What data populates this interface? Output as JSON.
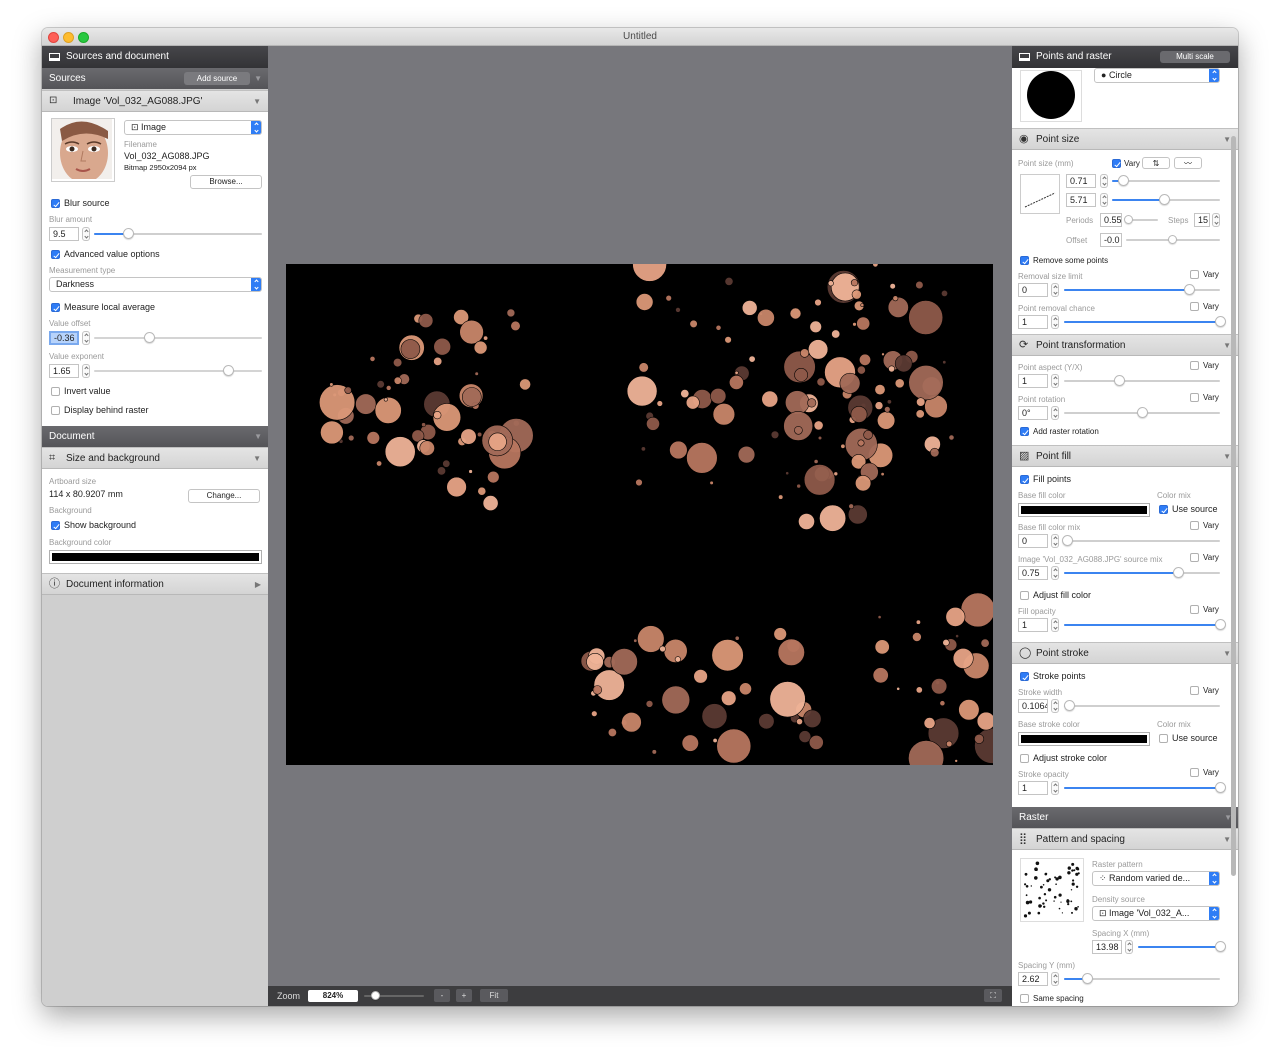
{
  "window": {
    "title": "Untitled"
  },
  "left_panel": {
    "header": "Sources and document",
    "sources_bar": "Sources",
    "add_source_label": "Add source",
    "image_source_title": "Image 'Vol_032_AG088.JPG'",
    "source_type": "Image",
    "filename_label": "Filename",
    "filename": "Vol_032_AG088.JPG",
    "bitmap_info": "Bitmap 2950x2094 px",
    "browse_label": "Browse...",
    "blur_source_label": "Blur source",
    "blur_amount_label": "Blur amount",
    "blur_amount": "9.5",
    "blur_slider": 0.2,
    "advanced_label": "Advanced value options",
    "measurement_type_label": "Measurement type",
    "measurement_type": "Darkness",
    "measure_local_label": "Measure local average",
    "value_offset_label": "Value offset",
    "value_offset": "-0.36",
    "value_offset_slider": 0.33,
    "value_exponent_label": "Value exponent",
    "value_exponent": "1.65",
    "value_exponent_slider": 0.8,
    "invert_label": "Invert value",
    "display_behind_label": "Display behind raster",
    "document_bar": "Document",
    "size_bg_title": "Size and background",
    "artboard_size_label": "Artboard size",
    "artboard_size": "114 x 80.9207 mm",
    "change_label": "Change...",
    "background_label": "Background",
    "show_background_label": "Show background",
    "background_color_label": "Background color",
    "background_color": "#000000",
    "doc_info_title": "Document information"
  },
  "zoom": {
    "label": "Zoom",
    "value": "824%",
    "minus": "-",
    "plus": "+",
    "fit": "Fit",
    "slider": 0.2
  },
  "right_panel": {
    "header": "Points and raster",
    "multi_scale": "Multi scale",
    "shape": "Circle",
    "point_size_title": "Point size",
    "point_size_label": "Point size (mm)",
    "vary_label": "Vary",
    "size_min": "0.71",
    "size_max": "5.71",
    "size_min_slider": 0.1,
    "size_max_slider": 0.48,
    "periods_label": "Periods",
    "periods": "0.55",
    "steps_label": "Steps",
    "steps": "15",
    "offset_label": "Offset",
    "offset": "-0.0",
    "remove_points_label": "Remove some points",
    "removal_limit_label": "Removal size limit",
    "removal_limit": "0",
    "removal_limit_slider": 0.8,
    "removal_chance_label": "Point removal chance",
    "removal_chance": "1",
    "removal_chance_slider": 1.0,
    "transform_title": "Point transformation",
    "aspect_label": "Point aspect (Y/X)",
    "aspect": "1",
    "aspect_slider": 0.35,
    "rotation_label": "Point rotation",
    "rotation": "0°",
    "rotation_slider": 0.5,
    "add_raster_rotation_label": "Add raster rotation",
    "fill_title": "Point fill",
    "fill_points_label": "Fill points",
    "base_fill_color_label": "Base fill color",
    "color_mix_label": "Color mix",
    "use_source_label": "Use source",
    "base_fill_mix_label": "Base fill color mix",
    "base_fill_mix": "0",
    "base_fill_mix_slider": 0.02,
    "source_mix_label": "Image 'Vol_032_AG088.JPG' source mix",
    "source_mix": "0.75",
    "source_mix_slider": 0.73,
    "adjust_fill_label": "Adjust fill color",
    "fill_opacity_label": "Fill opacity",
    "fill_opacity": "1",
    "fill_opacity_slider": 1.0,
    "stroke_title": "Point stroke",
    "stroke_points_label": "Stroke points",
    "stroke_width_label": "Stroke width",
    "stroke_width": "0.1064",
    "stroke_width_slider": 0.03,
    "base_stroke_color_label": "Base stroke color",
    "adjust_stroke_label": "Adjust stroke color",
    "stroke_opacity_label": "Stroke opacity",
    "stroke_opacity": "1",
    "stroke_opacity_slider": 1.0,
    "raster_bar": "Raster",
    "pattern_title": "Pattern and spacing",
    "raster_pattern_label": "Raster pattern",
    "raster_pattern": "Random varied de...",
    "density_source_label": "Density source",
    "density_source": "Image 'Vol_032_A...",
    "spacing_x_label": "Spacing X (mm)",
    "spacing_x": "13.98",
    "spacing_x_slider": 1.0,
    "spacing_y_label": "Spacing Y (mm)",
    "spacing_y": "2.62",
    "spacing_y_slider": 0.15,
    "same_spacing_label": "Same spacing",
    "fill_color": "#000000",
    "stroke_color": "#000000"
  },
  "accent": "#2e7cf6",
  "dot_color": "#d99a7c"
}
